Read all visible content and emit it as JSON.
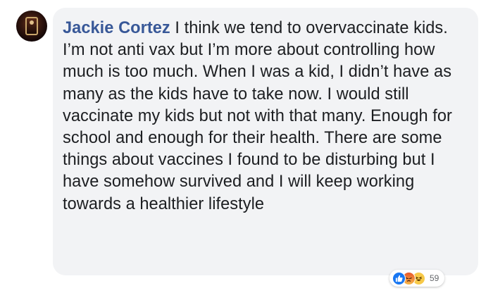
{
  "comment": {
    "author": "Jackie Cortez",
    "text": "I think we tend to overvaccinate kids. I’m not anti vax but I’m more about controlling how much is too much. When I was a kid, I didn’t have as many as the kids have to take now. I would still vaccinate my kids but not with that many. Enough for school and enough for their health. There are some things about vaccines I found to be disturbing but I have somehow survived and I will keep working towards a healthier lifestyle"
  },
  "reactions": {
    "icons": [
      "like-icon",
      "angry-icon",
      "haha-icon"
    ],
    "count": "59",
    "colors": {
      "like": "#1877f2",
      "angry": "#e9562a",
      "haha": "#f7c948"
    }
  },
  "colors": {
    "author_link": "#385898",
    "bubble_bg": "#f2f3f5",
    "text": "#1c1e21"
  }
}
